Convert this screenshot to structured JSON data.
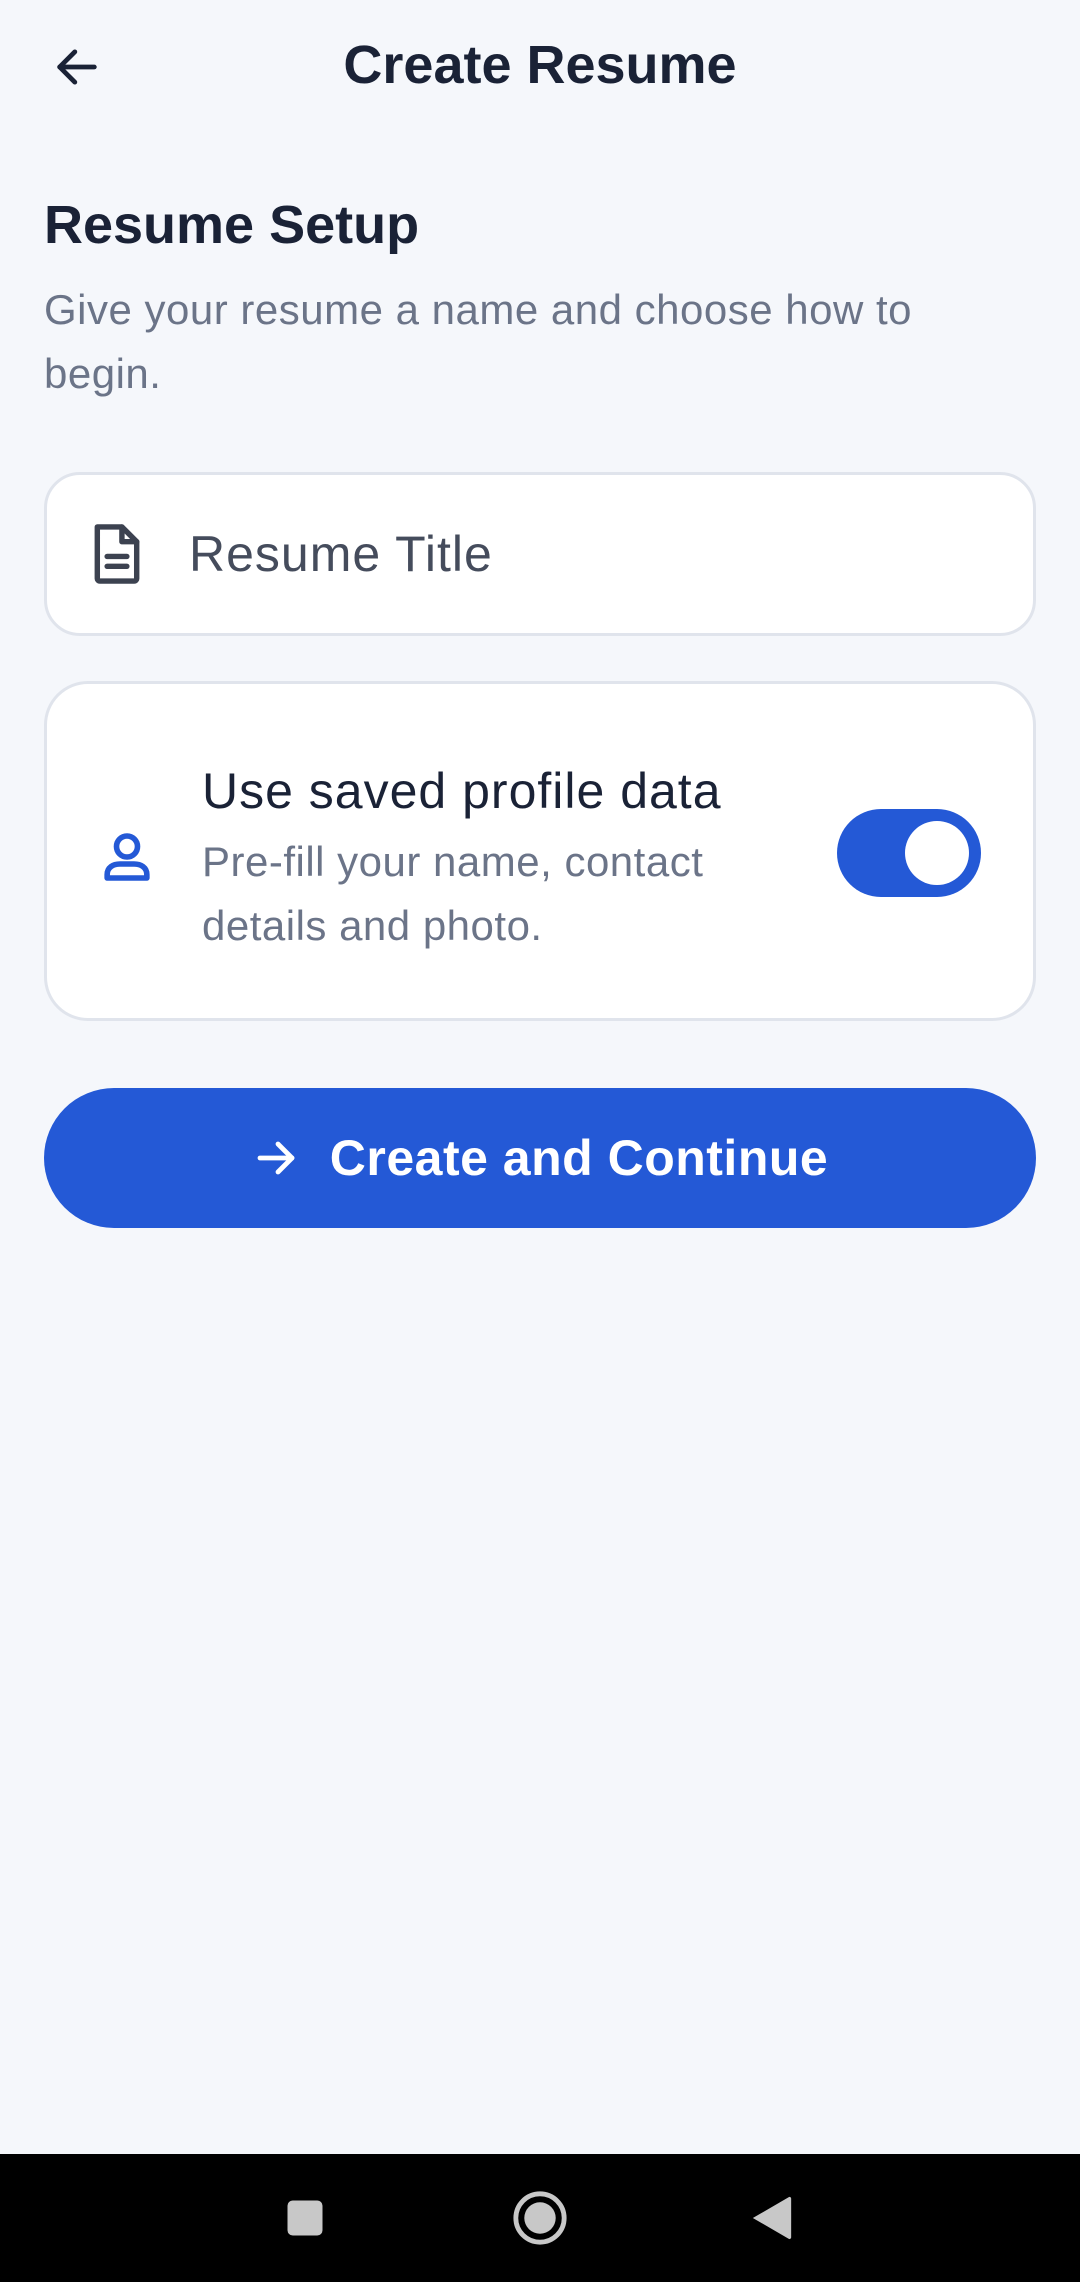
{
  "header": {
    "title": "Create Resume",
    "back_icon": "arrow-left-icon"
  },
  "setup": {
    "title": "Resume Setup",
    "subtitle": "Give your resume a name and choose how to begin."
  },
  "title_field": {
    "icon": "document-icon",
    "placeholder": "Resume Title",
    "value": ""
  },
  "profile_option": {
    "icon": "person-icon",
    "title": "Use saved profile data",
    "description": "Pre-fill your name, contact details and photo.",
    "enabled": true
  },
  "primary_action": {
    "icon": "arrow-right-icon",
    "label": "Create and Continue"
  },
  "system_nav": {
    "recents_icon": "square-icon",
    "home_icon": "circle-icon",
    "back_icon": "triangle-back-icon"
  },
  "colors": {
    "background": "#f5f7fb",
    "accent": "#2459d6",
    "text_primary": "#1a2236",
    "text_secondary": "#6b7488",
    "card_border": "#e0e4ec"
  }
}
